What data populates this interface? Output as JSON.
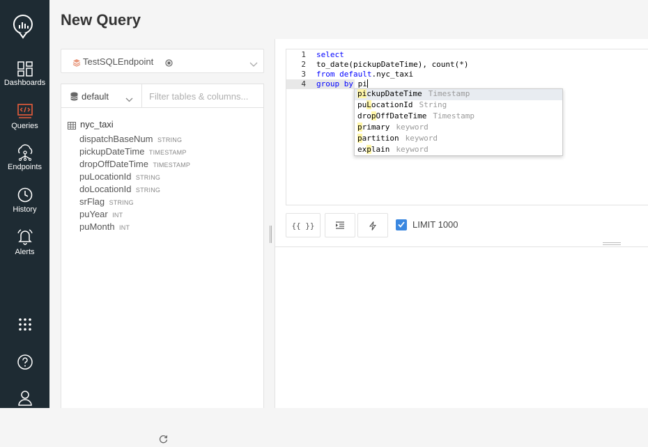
{
  "nav": {
    "items": [
      {
        "label": "Dashboards",
        "icon": "dashboards-icon"
      },
      {
        "label": "Queries",
        "icon": "queries-icon"
      },
      {
        "label": "Endpoints",
        "icon": "endpoints-icon"
      },
      {
        "label": "History",
        "icon": "history-icon"
      },
      {
        "label": "Alerts",
        "icon": "alerts-icon"
      }
    ],
    "active_color": "#e85d3b"
  },
  "page": {
    "title": "New Query"
  },
  "datasource": {
    "name": "TestSQLEndpoint"
  },
  "schema": {
    "database": "default",
    "filter_placeholder": "Filter tables & columns...",
    "table": {
      "name": "nyc_taxi",
      "columns": [
        {
          "name": "dispatchBaseNum",
          "type": "STRING"
        },
        {
          "name": "pickupDateTime",
          "type": "TIMESTAMP"
        },
        {
          "name": "dropOffDateTime",
          "type": "TIMESTAMP"
        },
        {
          "name": "puLocationId",
          "type": "STRING"
        },
        {
          "name": "doLocationId",
          "type": "STRING"
        },
        {
          "name": "srFlag",
          "type": "STRING"
        },
        {
          "name": "puYear",
          "type": "INT"
        },
        {
          "name": "puMonth",
          "type": "INT"
        }
      ]
    }
  },
  "editor": {
    "line_numbers": [
      "1",
      "2",
      "3",
      "4"
    ],
    "lines": {
      "l1_kw": "select",
      "l2": "to_date(pickupDateTime), count(*)",
      "l3_kw": "from",
      "l3_kw2": "default",
      "l3_rest": ".nyc_taxi",
      "l4_kw": "group by",
      "l4_rest": "pi"
    },
    "autocomplete": [
      {
        "pre": "",
        "hl": "pi",
        "post": "ckupDateTime",
        "meta": "Timestamp"
      },
      {
        "pre": "pu",
        "hl": "L",
        "post": "ocationId",
        "meta": "String"
      },
      {
        "pre": "dro",
        "hl": "p",
        "post": "OffDateTime",
        "meta": "Timestamp"
      },
      {
        "pre": "",
        "hl": "p",
        "post": "rimary",
        "meta": "keyword"
      },
      {
        "pre": "",
        "hl": "p",
        "post": "artition",
        "meta": "keyword"
      },
      {
        "pre": "ex",
        "hl": "p",
        "post": "lain",
        "meta": "keyword"
      }
    ]
  },
  "toolbar": {
    "params_label": "{{ }}",
    "limit_label": "LIMIT 1000",
    "limit_checked": true
  }
}
